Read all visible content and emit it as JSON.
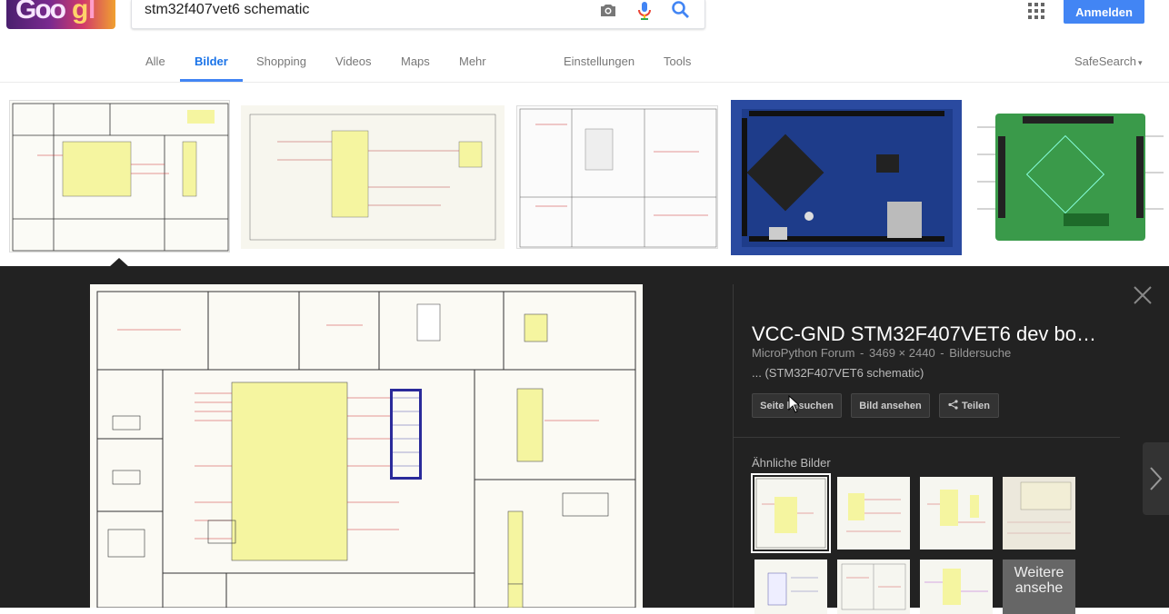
{
  "header": {
    "logo_alt": "Google",
    "search_value": "stm32f407vet6 schematic",
    "signin_label": "Anmelden",
    "icons": [
      "camera-icon",
      "microphone-icon",
      "search-icon",
      "apps-icon"
    ]
  },
  "tabs": [
    {
      "label": "Alle"
    },
    {
      "label": "Bilder",
      "active": true
    },
    {
      "label": "Shopping"
    },
    {
      "label": "Videos"
    },
    {
      "label": "Maps"
    },
    {
      "label": "Mehr"
    },
    {
      "label": "Einstellungen"
    },
    {
      "label": "Tools"
    }
  ],
  "safesearch_label": "SafeSearch",
  "panel": {
    "title": "VCC-GND STM32F407VET6 dev bo…",
    "source": "MicroPython Forum",
    "dimensions": "3469 × 2440",
    "type": "Bildersuche",
    "separator": "-",
    "description": "... (STM32F407VET6 schematic)",
    "buttons": {
      "visit": "Seite besuchen",
      "view": "Bild ansehen",
      "share": "Teilen"
    },
    "similar_label": "Ähnliche Bilder",
    "more_label": "Weitere ansehe"
  },
  "colors": {
    "accent": "#4285f4",
    "viewer_bg": "#222222",
    "schematic_yellow": "#f5f5a0",
    "board_blue": "#2a4aa0",
    "board_green": "#3a9a4a"
  }
}
